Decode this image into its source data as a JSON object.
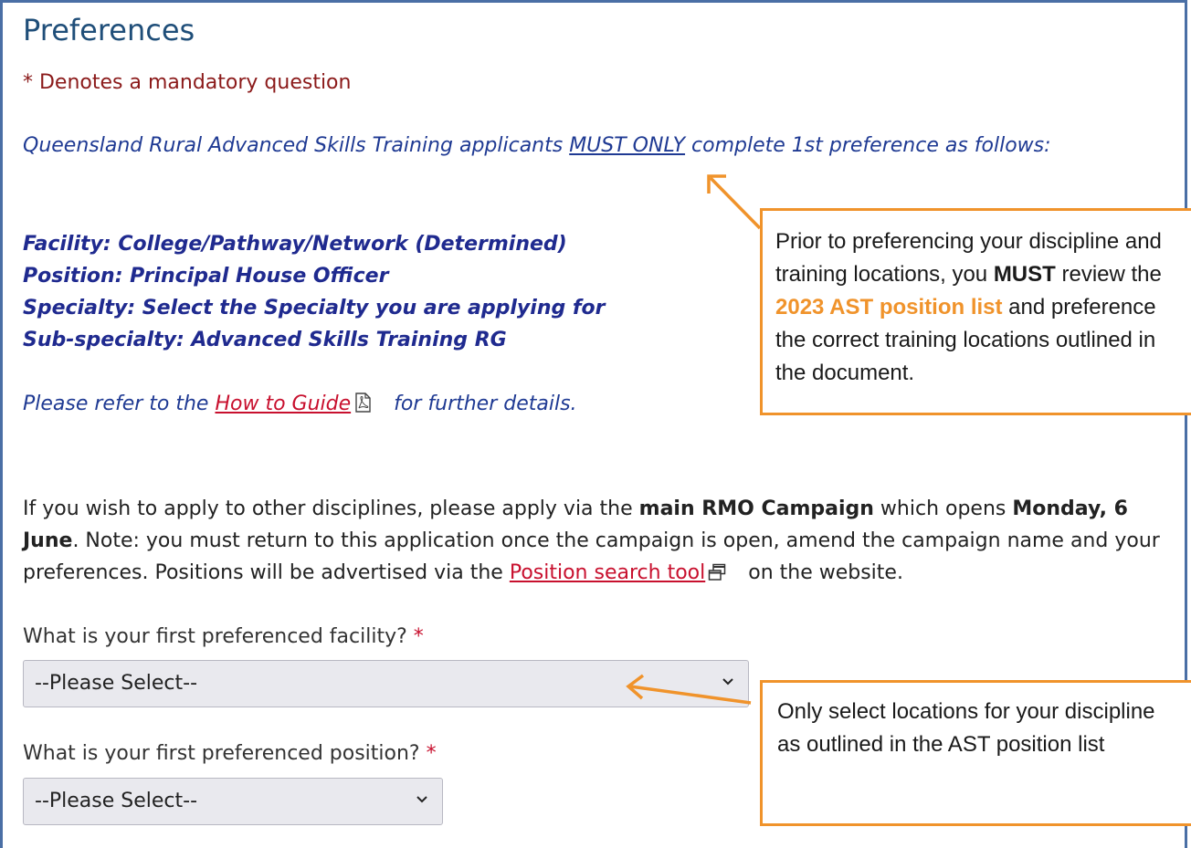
{
  "page": {
    "title": "Preferences",
    "mandatory_note": "* Denotes a mandatory question"
  },
  "intro": {
    "text_before": "Queensland Rural Advanced Skills Training applicants ",
    "emphasis": "MUST ONLY",
    "text_after": " complete 1st preference as follows:"
  },
  "facility_lines": [
    "Facility: College/Pathway/Network (Determined)",
    "Position: Principal House Officer",
    "Specialty: Select the Specialty you are applying for",
    "Sub-specialty: Advanced Skills Training RG"
  ],
  "guide": {
    "prefix": "Please refer to the ",
    "link": "How to Guide",
    "suffix": "for further details."
  },
  "info": {
    "t1": "If you wish to apply to other disciplines, please apply via the ",
    "b1": "main RMO Campaign",
    "t2": " which opens ",
    "b2": "Monday, 6 June",
    "t3": ". Note: you must return to this application once the campaign is open, amend the campaign name and your preferences. Positions will be advertised via the ",
    "link": "Position search tool",
    "t4": "on the website."
  },
  "questions": [
    {
      "label": "What is your first preferenced facility?",
      "required_mark": "*",
      "selected": "--Please Select--"
    },
    {
      "label": "What is your first preferenced position?",
      "required_mark": "*",
      "selected": "--Please Select--"
    }
  ],
  "callouts": {
    "top": {
      "t1": "Prior to preferencing your discipline and training locations, you ",
      "b1": "MUST",
      "t2": " review the ",
      "highlight": "2023 AST position list",
      "t3": " and preference the correct training locations outlined in the document."
    },
    "bottom": {
      "text": "Only select locations for your discipline as outlined in the AST position list"
    }
  },
  "colors": {
    "accent_orange": "#f0932b",
    "link_red": "#c8102e",
    "title_blue": "#1f4e79",
    "frame_blue": "#4a6fa5"
  },
  "icons": [
    "pdf-icon",
    "new-window-icon",
    "chevron-down-icon",
    "arrow-icon"
  ]
}
